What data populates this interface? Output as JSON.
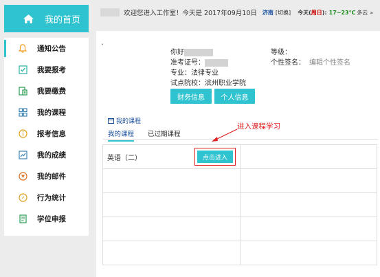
{
  "sidebar": {
    "home_label": "我的首页",
    "items": [
      {
        "label": "通知公告",
        "icon": "bell-icon",
        "active": true
      },
      {
        "label": "我要报考",
        "icon": "checkbox-icon"
      },
      {
        "label": "我要缴费",
        "icon": "payment-icon"
      },
      {
        "label": "我的课程",
        "icon": "grid-icon"
      },
      {
        "label": "报考信息",
        "icon": "info-icon"
      },
      {
        "label": "我的成绩",
        "icon": "chart-icon"
      },
      {
        "label": "我的邮件",
        "icon": "mail-icon"
      },
      {
        "label": "行为统计",
        "icon": "compass-icon"
      },
      {
        "label": "学位申报",
        "icon": "document-icon"
      }
    ]
  },
  "topbar": {
    "welcome": "欢迎您进入工作室！今天是 2017年09月10日",
    "city": "济南",
    "switch_label": "[切换]",
    "day_label": "今天(",
    "weekday": "周日",
    "day_close": "):",
    "temperature": "17~23℃",
    "weather": "多云",
    "more": "»"
  },
  "profile": {
    "greeting": "你好",
    "exam_id_label": "准考证号：",
    "major": "专业：法律专业",
    "school": "试点院校：滨州职业学院",
    "level_label": "等级：",
    "signature_label": "个性签名：",
    "edit_signature": "编辑个性签名",
    "finance_button": "财务信息",
    "personal_button": "个人信息"
  },
  "courses": {
    "title": "我的课程",
    "tabs": [
      "我的课程",
      "已过期课程"
    ],
    "annotation": "进入课程学习",
    "rows": [
      {
        "name": "英语（二）",
        "action": "点击进入"
      }
    ],
    "colors": {
      "accent": "#2fc2cf",
      "annotation": "#e02020"
    }
  }
}
